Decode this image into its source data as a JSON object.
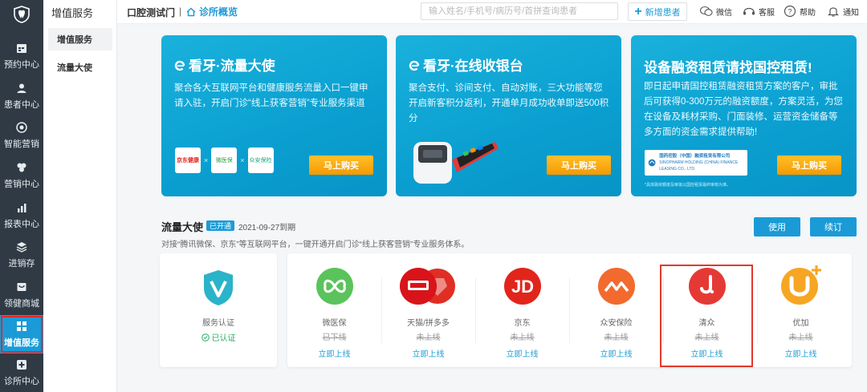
{
  "sidebar": {
    "items": [
      {
        "label": "预约中心",
        "icon": "calendar-icon"
      },
      {
        "label": "患者中心",
        "icon": "person-icon"
      },
      {
        "label": "智能营销",
        "icon": "target-icon"
      },
      {
        "label": "营销中心",
        "icon": "leaf-icon"
      },
      {
        "label": "报表中心",
        "icon": "bar-chart-icon"
      },
      {
        "label": "进销存",
        "icon": "layers-icon"
      },
      {
        "label": "领健商城",
        "icon": "mall-icon"
      },
      {
        "label": "增值服务",
        "icon": "grid-icon"
      },
      {
        "label": "诊所中心",
        "icon": "clinic-icon"
      }
    ]
  },
  "submenu": {
    "title": "增值服务",
    "items": [
      "增值服务",
      "流量大使"
    ]
  },
  "header": {
    "clinic": "口腔测试门",
    "separator": "|",
    "overview": "诊所概览",
    "search_placeholder": "输入姓名/手机号/病历号/首拼查询患者",
    "add_patient": "新增患者",
    "links": [
      "微信",
      "客服",
      "帮助",
      "通知"
    ]
  },
  "banners": [
    {
      "title": "看牙·流量大使",
      "desc": "聚合各大互联网平台和健康服务流量入口一键申请入驻，开启门诊“线上获客营销”专业服务渠道",
      "button": "马上购买",
      "logos": [
        "京东健康",
        "微医保",
        "众安保险"
      ]
    },
    {
      "title": "看牙·在线收银台",
      "desc": "聚合支付、诊间支付、自动对账，三大功能等您开启新客积分返利，开通单月成功收单即送500积分",
      "button": "马上购买"
    },
    {
      "title": "设备融资租赁请找国控租赁!",
      "desc": "即日起申请国控租赁融资租赁方案的客户，审批后可获得0-300万元的融资额度，方案灵活，为您在设备及耗材采购、门面装修、运营资金储备等多方面的资金需求提供帮助!",
      "button": "马上购买",
      "company": "国药控股（中国）融资租赁有限公司",
      "company_en": "SINOPHARM HOLDING (CHINA) FINANCE LEASING CO., LTD.",
      "note": "*具体融资额度及审批以国控租赁最终审核为准。"
    }
  ],
  "section": {
    "title": "流量大使",
    "badge": "已开通",
    "expire": "2021-09-27到期",
    "desc": "对接“腾讯微保、京东”等互联网平台，一键开通开启门诊“线上获客营销”专业服务体系。",
    "use_button": "使用",
    "renew_button": "续订"
  },
  "certification": {
    "name": "服务认证",
    "status": "已认证"
  },
  "services": [
    {
      "name": "微医保",
      "status": "已下线",
      "link": "立即上线",
      "icon": "weiyibao-icon"
    },
    {
      "name": "天猫/拼多多",
      "status": "未上线",
      "link": "立即上线",
      "icon": "tmall-pdd-icon"
    },
    {
      "name": "京东",
      "status": "未上线",
      "link": "立即上线",
      "icon": "jd-icon"
    },
    {
      "name": "众安保险",
      "status": "未上线",
      "link": "立即上线",
      "icon": "zhongan-icon"
    },
    {
      "name": "清众",
      "status": "未上线",
      "link": "立即上线",
      "icon": "qingzhong-icon"
    },
    {
      "name": "优加",
      "status": "未上线",
      "link": "立即上线",
      "icon": "youjia-icon"
    }
  ],
  "colors": {
    "accent": "#1a9bd7",
    "sidebar_bg": "#2f3a45",
    "buy_button": "#f5a000",
    "highlight": "#e0392b"
  }
}
